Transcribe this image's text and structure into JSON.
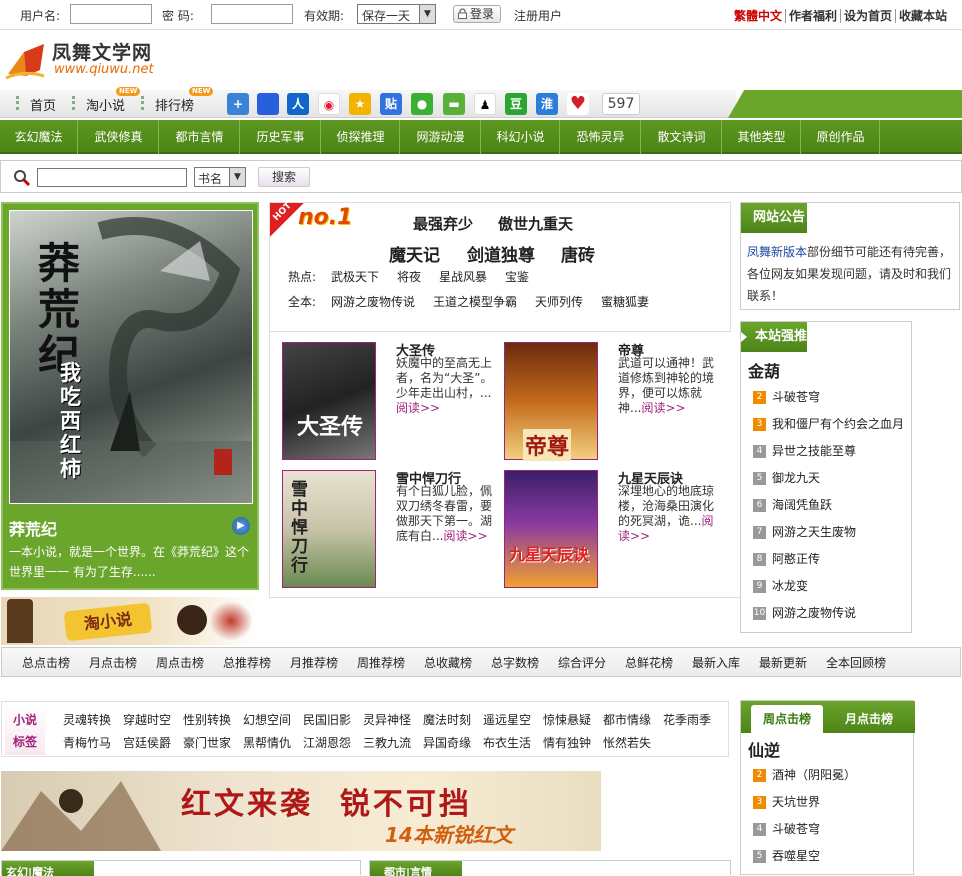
{
  "login": {
    "username_label": "用户名:",
    "password_label": "密  码:",
    "expiry_label": "有效期:",
    "expiry_value": "保存一天",
    "login_button": "登录",
    "register_link": "注册用户",
    "links": [
      "繁體中文",
      "作者福利",
      "设为首页",
      "收藏本站"
    ]
  },
  "site": {
    "name": "凤舞文学网",
    "url": "www.qiuwu.net"
  },
  "nav": {
    "items": [
      {
        "label": "首页",
        "badge": ""
      },
      {
        "label": "淘小说",
        "badge": "NEW"
      },
      {
        "label": "排行榜",
        "badge": "NEW"
      }
    ],
    "share_icons": [
      "add-icon",
      "baidu-icon",
      "renren-icon",
      "weibo-icon",
      "qzone-icon",
      "tieba-icon",
      "wechat-icon",
      "moments-icon",
      "qq-icon",
      "douban-icon",
      "youdao-icon",
      "heart-icon"
    ],
    "share_count": "597"
  },
  "categories": [
    "玄幻魔法",
    "武侠修真",
    "都市言情",
    "历史军事",
    "侦探推理",
    "网游动漫",
    "科幻小说",
    "恐怖灵异",
    "散文诗词",
    "其他类型",
    "原创作品"
  ],
  "search": {
    "value": "",
    "type_value": "书名",
    "button": "搜索"
  },
  "feature": {
    "title": "莽荒纪",
    "cover_text": "莽荒纪",
    "cover_author": "我吃西红柿",
    "desc": "一本小说，就是一个世界。在《莽荒纪》这个世界里一一 有为了生存......"
  },
  "banner1": {
    "text": "淘小说"
  },
  "hot": {
    "badge": "HOT",
    "rank_label": "no.1",
    "row1": [
      "最强弃少",
      "傲世九重天"
    ],
    "row2": [
      "魔天记",
      "剑道独尊",
      "唐砖"
    ],
    "row3_label": "热点:",
    "row3": [
      "武极天下",
      "将夜",
      "星战风暴",
      "宝鉴"
    ],
    "row4_label": "全本:",
    "row4": [
      "网游之废物传说",
      "王道之模型争霸",
      "天师列传",
      "蜜糖狐妻"
    ]
  },
  "books": [
    {
      "title": "大圣传",
      "desc": "妖魔中的至高无上者，名为“大圣”。少年走出山村，...",
      "cover_text": "大圣传",
      "read": "阅读>>"
    },
    {
      "title": "帝尊",
      "desc": "武道可以通神！武道修炼到神轮的境界，便可以炼就神...",
      "cover_text": "帝尊",
      "read": "阅读>>"
    },
    {
      "title": "雪中悍刀行",
      "desc": "有个白狐儿脸，佩双刀绣冬春雷，要做那天下第一。湖底有白...",
      "cover_text": "雪中悍刀行",
      "read": "阅读>>"
    },
    {
      "title": "九星天辰诀",
      "desc": "深埋地心的地底琼楼，沧海桑田演化的死冥湖，诡...",
      "cover_text": "九星天辰诀",
      "read": "阅读>>"
    }
  ],
  "notice": {
    "heading": "网站公告",
    "link": "凤舞新版本",
    "text": "部份细节可能还有待完善，各位网友如果发现问题，请及时和我们联系！"
  },
  "rank": {
    "heading": "本站强推",
    "top": "金葫",
    "items": [
      {
        "num": "2",
        "name": "斗破苍穹"
      },
      {
        "num": "3",
        "name": "我和僵尸有个约会之血月"
      },
      {
        "num": "4",
        "name": "异世之技能至尊"
      },
      {
        "num": "5",
        "name": "御龙九天"
      },
      {
        "num": "6",
        "name": "海阔凭鱼跃"
      },
      {
        "num": "7",
        "name": "网游之天生废物"
      },
      {
        "num": "8",
        "name": "阿憨正传"
      },
      {
        "num": "9",
        "name": "冰龙变"
      },
      {
        "num": "10",
        "name": "网游之废物传说"
      }
    ]
  },
  "rank_tabs": [
    "总点击榜",
    "月点击榜",
    "周点击榜",
    "总推荐榜",
    "月推荐榜",
    "周推荐榜",
    "总收藏榜",
    "总字数榜",
    "综合评分",
    "总鲜花榜",
    "最新入库",
    "最新更新",
    "全本回顾榜"
  ],
  "tags": {
    "title1": "小说",
    "title2": "标签",
    "row1": [
      "灵魂转换",
      "穿越时空",
      "性别转换",
      "幻想空间",
      "民国旧影",
      "灵异神怪",
      "魔法时刻",
      "遥远星空",
      "惊悚悬疑",
      "都市情缘",
      "花季雨季"
    ],
    "row2": [
      "青梅竹马",
      "宫廷侯爵",
      "豪门世家",
      "黑帮情仇",
      "江湖恩怨",
      "三教九流",
      "异国奇缘",
      "布衣生活",
      "情有独钟",
      "怅然若失"
    ]
  },
  "banner2": {
    "headline": "红文来袭  锐不可挡",
    "sub": "14本新锐红文"
  },
  "rank2": {
    "tabs": [
      "周点击榜",
      "月点击榜"
    ],
    "top": "仙逆",
    "items": [
      {
        "num": "2",
        "name": "酒神（阴阳冕）"
      },
      {
        "num": "3",
        "name": "天坑世界"
      },
      {
        "num": "4",
        "name": "斗破苍穹"
      },
      {
        "num": "5",
        "name": "吞噬星空"
      }
    ]
  },
  "bottom_panels": [
    "玄幻|魔法",
    "都市|言情"
  ]
}
